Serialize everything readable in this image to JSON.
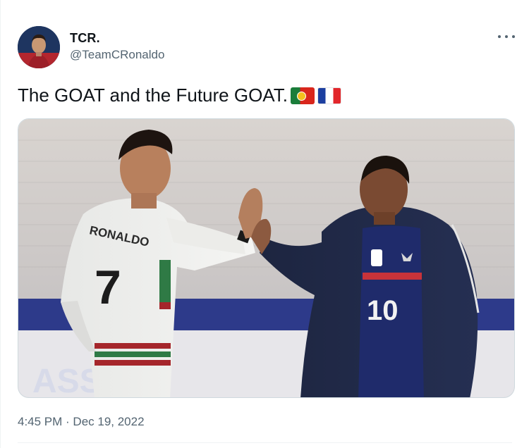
{
  "tweet": {
    "author": {
      "display_name": "TCR.",
      "handle": "@TeamCRonaldo",
      "avatar_icon": "profile-photo-avatar"
    },
    "more_icon": "more-horizontal-icon",
    "text": "The GOAT and the Future GOAT.",
    "emojis": [
      "flag-portugal",
      "flag-france"
    ],
    "media": {
      "kind": "photo",
      "jersey_name": "RONALDO",
      "jersey_number_left": "7",
      "jersey_number_right": "10"
    },
    "timestamp": "4:45 PM · Dec 19, 2022"
  },
  "colors": {
    "text_primary": "#0f1419",
    "text_secondary": "#536471",
    "border": "#cfd9de"
  }
}
